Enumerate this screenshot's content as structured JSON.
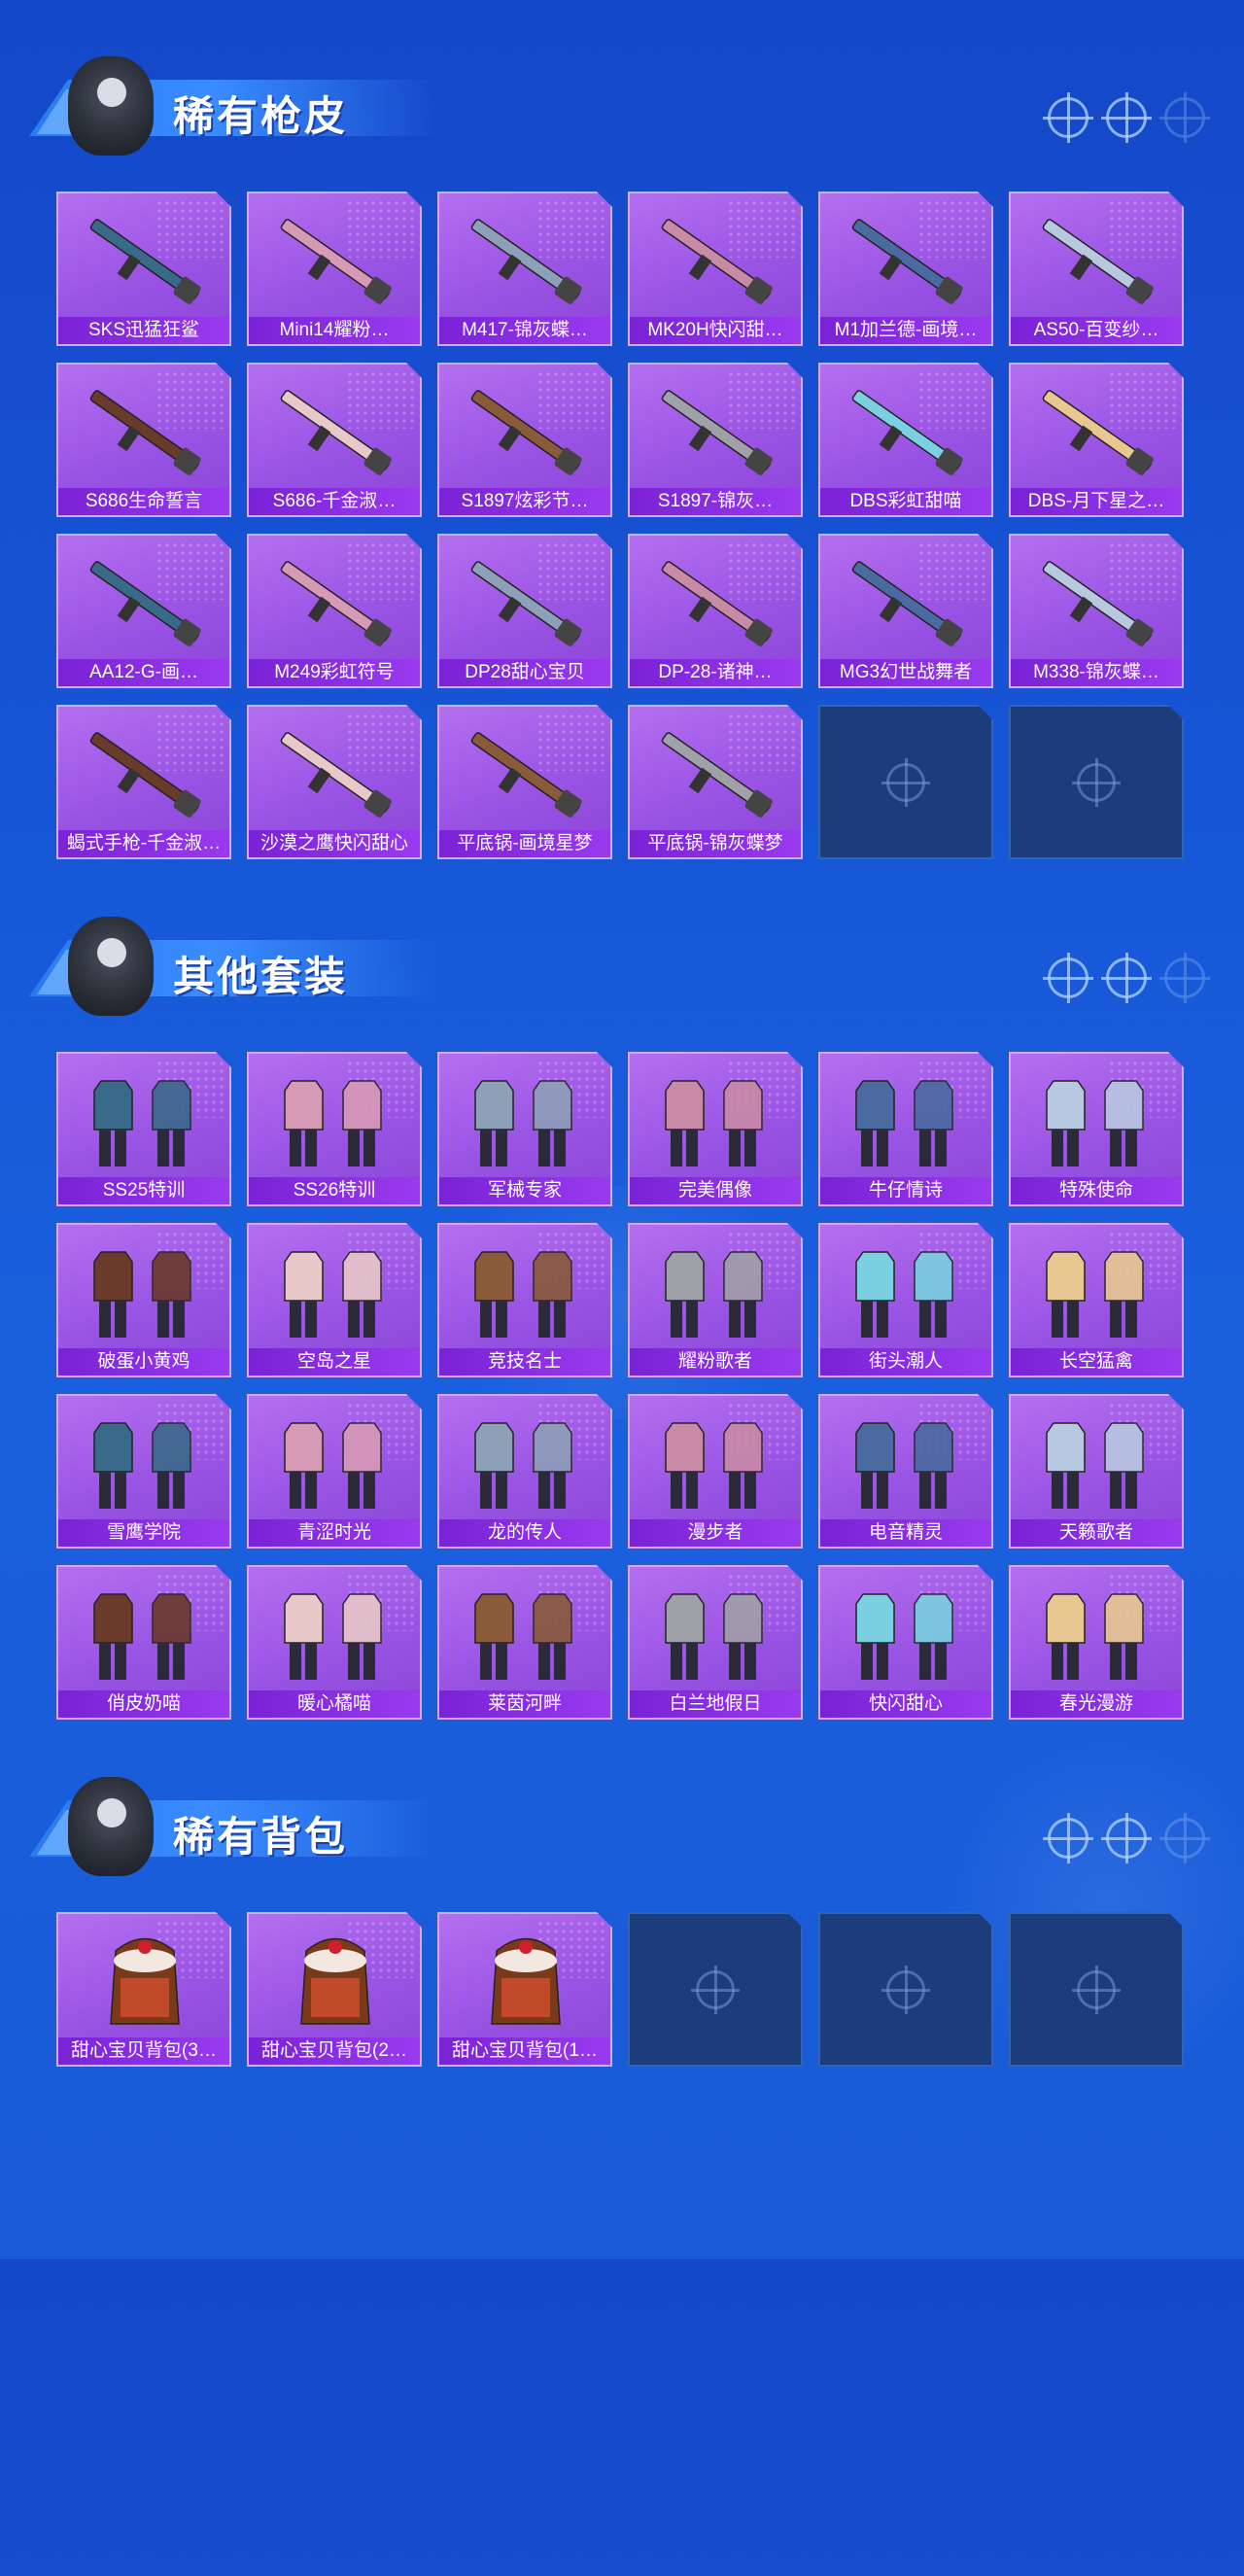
{
  "sections": [
    {
      "title": "稀有枪皮",
      "kind": "gun",
      "items": [
        "SKS迅猛狂鲨",
        "Mini14耀粉…",
        "M417-锦灰蝶…",
        "MK20H快闪甜…",
        "M1加兰德-画境…",
        "AS50-百变纱…",
        "S686生命誓言",
        "S686-千金淑…",
        "S1897炫彩节…",
        "S1897-锦灰…",
        "DBS彩虹甜喵",
        "DBS-月下星之…",
        "AA12-G-画…",
        "M249彩虹符号",
        "DP28甜心宝贝",
        "DP-28-诸神…",
        "MG3幻世战舞者",
        "M338-锦灰蝶…",
        "蝎式手枪-千金淑…",
        "沙漠之鹰快闪甜心",
        "平底锅-画境星梦",
        "平底锅-锦灰蝶梦",
        "",
        ""
      ]
    },
    {
      "title": "其他套装",
      "kind": "outfit",
      "items": [
        "SS25特训",
        "SS26特训",
        "军械专家",
        "完美偶像",
        "牛仔情诗",
        "特殊使命",
        "破蛋小黄鸡",
        "空岛之星",
        "竞技名士",
        "耀粉歌者",
        "街头潮人",
        "长空猛禽",
        "雪鹰学院",
        "青涩时光",
        "龙的传人",
        "漫步者",
        "电音精灵",
        "天籁歌者",
        "俏皮奶喵",
        "暖心橘喵",
        "莱茵河畔",
        "白兰地假日",
        "快闪甜心",
        "春光漫游"
      ]
    },
    {
      "title": "稀有背包",
      "kind": "bag",
      "items": [
        "甜心宝贝背包(3…",
        "甜心宝贝背包(2…",
        "甜心宝贝背包(1…",
        "",
        "",
        ""
      ]
    }
  ],
  "colors": {
    "background": "#1656d6",
    "card": "#9a54e4",
    "card_label": "#8a2ee6",
    "empty_card": "#1d3c7c"
  },
  "icons": [
    "crosshair-icon",
    "mascot-icon"
  ]
}
